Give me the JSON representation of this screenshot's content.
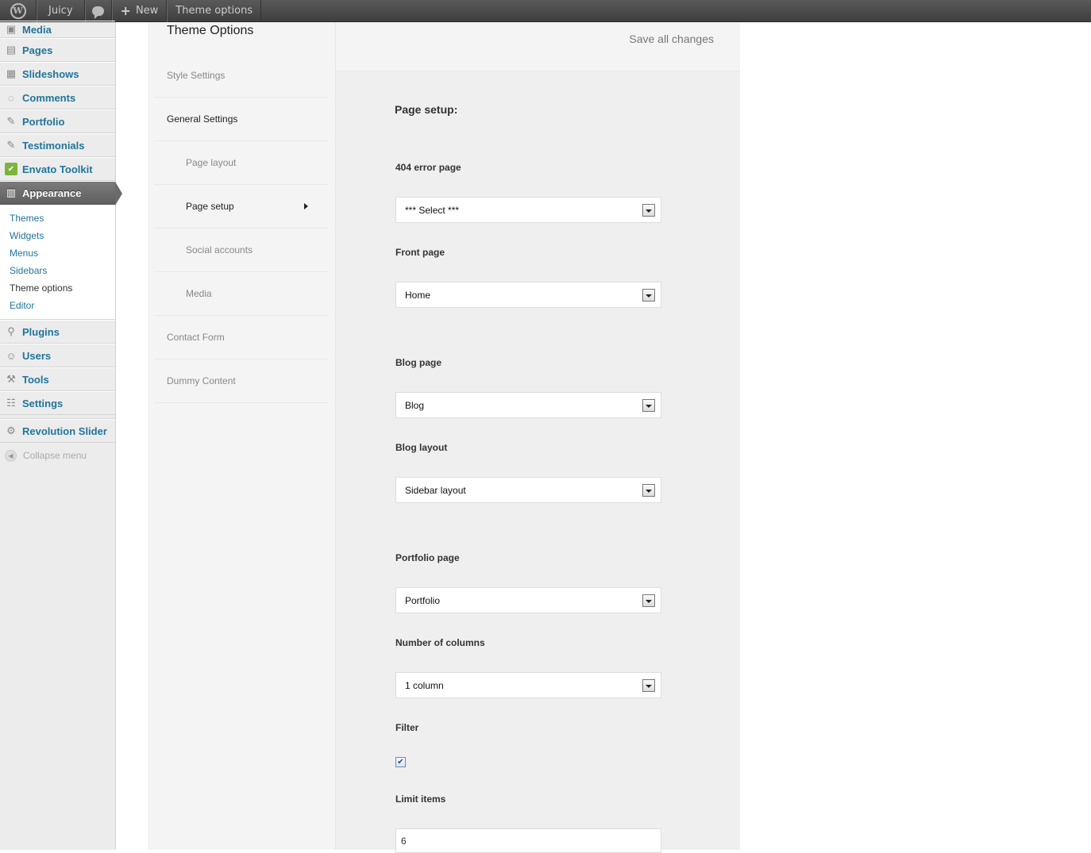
{
  "adminbar": {
    "site_name": "Juicy",
    "new_label": "New",
    "page_label": "Theme options"
  },
  "menu": {
    "items_top": [
      {
        "label": "Media",
        "icon": "media-icon"
      },
      {
        "label": "Pages",
        "icon": "pages-icon"
      },
      {
        "label": "Slideshows",
        "icon": "slideshows-icon"
      },
      {
        "label": "Comments",
        "icon": "comments-icon"
      },
      {
        "label": "Portfolio",
        "icon": "pin-icon"
      },
      {
        "label": "Testimonials",
        "icon": "pin-icon"
      },
      {
        "label": "Envato Toolkit",
        "icon": "envato-icon"
      }
    ],
    "appearance": "Appearance",
    "appearance_sub": [
      "Themes",
      "Widgets",
      "Menus",
      "Sidebars",
      "Theme options",
      "Editor"
    ],
    "items_bottom": [
      {
        "label": "Plugins",
        "icon": "plugins-icon"
      },
      {
        "label": "Users",
        "icon": "users-icon"
      },
      {
        "label": "Tools",
        "icon": "tools-icon"
      },
      {
        "label": "Settings",
        "icon": "settings-icon"
      }
    ],
    "revolution": "Revolution Slider",
    "collapse": "Collapse menu"
  },
  "panel": {
    "title": "Theme Options",
    "save_label": "Save all changes",
    "tabs": [
      {
        "label": "Style Settings"
      },
      {
        "label": "General Settings"
      },
      {
        "label": "Page layout"
      },
      {
        "label": "Page setup"
      },
      {
        "label": "Social accounts"
      },
      {
        "label": "Media"
      },
      {
        "label": "Contact Form"
      },
      {
        "label": "Dummy Content"
      }
    ]
  },
  "form": {
    "section_title": "Page setup:",
    "error_page_label": "404 error page",
    "error_page_value": "*** Select ***",
    "front_page_label": "Front page",
    "front_page_value": "Home",
    "blog_page_label": "Blog page",
    "blog_page_value": "Blog",
    "blog_layout_label": "Blog layout",
    "blog_layout_value": "Sidebar layout",
    "portfolio_page_label": "Portfolio page",
    "portfolio_page_value": "Portfolio",
    "columns_label": "Number of columns",
    "columns_value": "1 column",
    "filter_label": "Filter",
    "filter_checked": true,
    "limit_label": "Limit items",
    "limit_value": "6"
  }
}
